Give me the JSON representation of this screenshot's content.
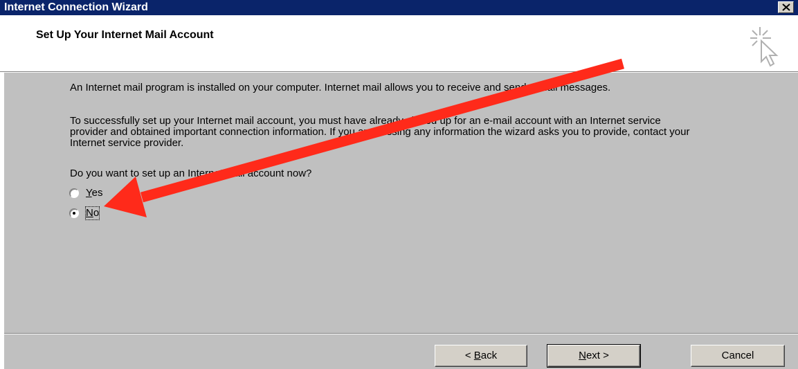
{
  "window": {
    "title": "Internet Connection Wizard"
  },
  "header": {
    "title": "Set Up Your Internet Mail Account",
    "icon": "wizard-cursor-icon"
  },
  "content": {
    "paragraph1": "An Internet mail program is installed on your computer. Internet mail allows you to receive and send e-mail messages.",
    "paragraph2": "To successfully set up your Internet mail account, you must have already signed up for an e-mail account with an Internet service provider and obtained important connection information. If you are missing any information the wizard asks you to provide, contact your Internet service provider.",
    "question": "Do you want to set up an Internet mail account now?",
    "options": [
      {
        "label_accel": "Y",
        "label_rest": "es",
        "selected": false
      },
      {
        "label_accel": "N",
        "label_rest": "o",
        "selected": true
      }
    ]
  },
  "footer": {
    "back": {
      "prefix": "< ",
      "accel": "B",
      "rest": "ack"
    },
    "next": {
      "accel": "N",
      "rest": "ext >"
    },
    "cancel": "Cancel"
  },
  "annotation": {
    "arrow_color": "#ff2a1a",
    "arrow_target": "No"
  }
}
